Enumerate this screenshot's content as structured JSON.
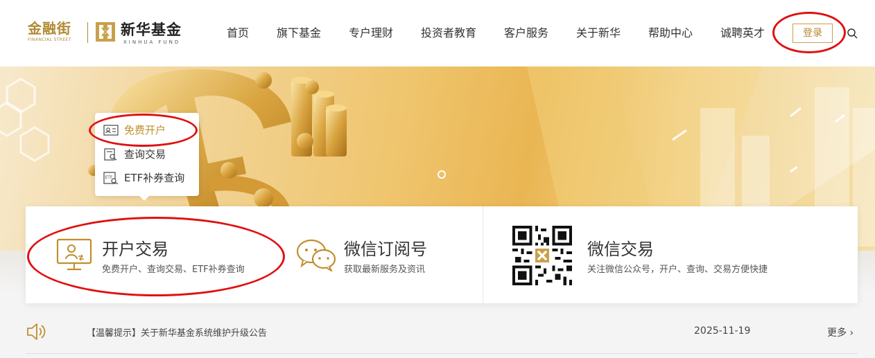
{
  "logos": {
    "financial_street_cn": "金融街",
    "financial_street_en": "FINANCIAL STREET",
    "xinhua_cn": "新华基金",
    "xinhua_en": "XINHUA FUND"
  },
  "nav": {
    "items": [
      {
        "label": "首页"
      },
      {
        "label": "旗下基金"
      },
      {
        "label": "专户理财"
      },
      {
        "label": "投资者教育"
      },
      {
        "label": "客户服务"
      },
      {
        "label": "关于新华"
      },
      {
        "label": "帮助中心"
      },
      {
        "label": "诚聘英才"
      }
    ],
    "login_label": "登录"
  },
  "quick_menu": {
    "items": [
      {
        "label": "免费开户",
        "icon": "id-card-icon"
      },
      {
        "label": "查询交易",
        "icon": "search-doc-icon"
      },
      {
        "label": "ETF补券查询",
        "icon": "etf-search-icon"
      }
    ]
  },
  "services": [
    {
      "title": "开户交易",
      "desc": "免费开户、查询交易、ETF补券查询",
      "icon": "monitor-user-icon"
    },
    {
      "title": "微信订阅号",
      "desc": "获取最新服务及资讯",
      "icon": "wechat-icon"
    },
    {
      "title": "微信交易",
      "desc": "关注微信公众号，开户、查询、交易方便快捷",
      "icon": "qr-code-icon"
    }
  ],
  "notice": {
    "text": "【温馨提示】关于新华基金系统维护升级公告",
    "date": "2025-11-19",
    "more": "更多 ›"
  },
  "colors": {
    "accent_gold": "#c08e2c",
    "annotation_red": "#e01010"
  }
}
